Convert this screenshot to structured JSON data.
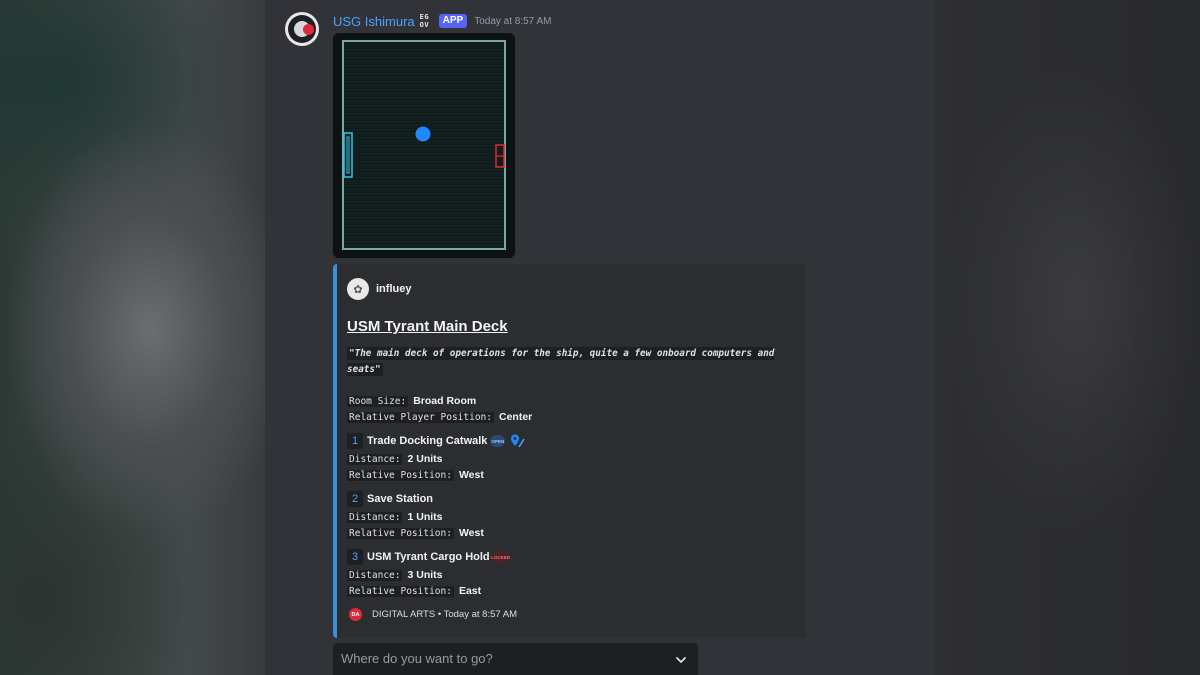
{
  "message": {
    "username": "USG Ishimura",
    "badge_glyph": "EG\nOV",
    "app_badge": "APP",
    "timestamp": "Today at 8:57 AM"
  },
  "embed": {
    "accent_color": "#3a8fd8",
    "author": {
      "name": "influey",
      "avatar_glyph": "✿"
    },
    "title": "USM Tyrant Main Deck",
    "description": "\"The main deck of operations for the ship, quite a few onboard computers and seats\"",
    "fields": [
      {
        "key": "Room Size:",
        "value": "Broad Room"
      },
      {
        "key": "Relative Player Position:",
        "value": "Center"
      }
    ],
    "destinations": [
      {
        "number": "1",
        "name": "Trade Docking Catwalk",
        "status": "OPEN",
        "status_color": "#9cc8ff",
        "distance_label": "Distance:",
        "distance": "2 Units",
        "position_label": "Relative Position:",
        "position": "West",
        "icon": "map-pin-icon"
      },
      {
        "number": "2",
        "name": "Save Station",
        "distance_label": "Distance:",
        "distance": "1 Units",
        "position_label": "Relative Position:",
        "position": "West"
      },
      {
        "number": "3",
        "name": "USM Tyrant Cargo Hold",
        "status": "LOCKED",
        "status_color": "#ff6b70",
        "distance_label": "Distance:",
        "distance": "3 Units",
        "position_label": "Relative Position:",
        "position": "East"
      }
    ],
    "footer": {
      "icon_text": "DA",
      "text": "DIGITAL ARTS • Today at 8:57 AM"
    }
  },
  "select_menu": {
    "placeholder": "Where do you want to go?"
  },
  "colors": {
    "username": "#4aa3ff",
    "app_badge": "#5865f2",
    "player_marker": "#1e88ff",
    "west_exit": "#2fc6e8",
    "east_exit": "#e02828"
  }
}
